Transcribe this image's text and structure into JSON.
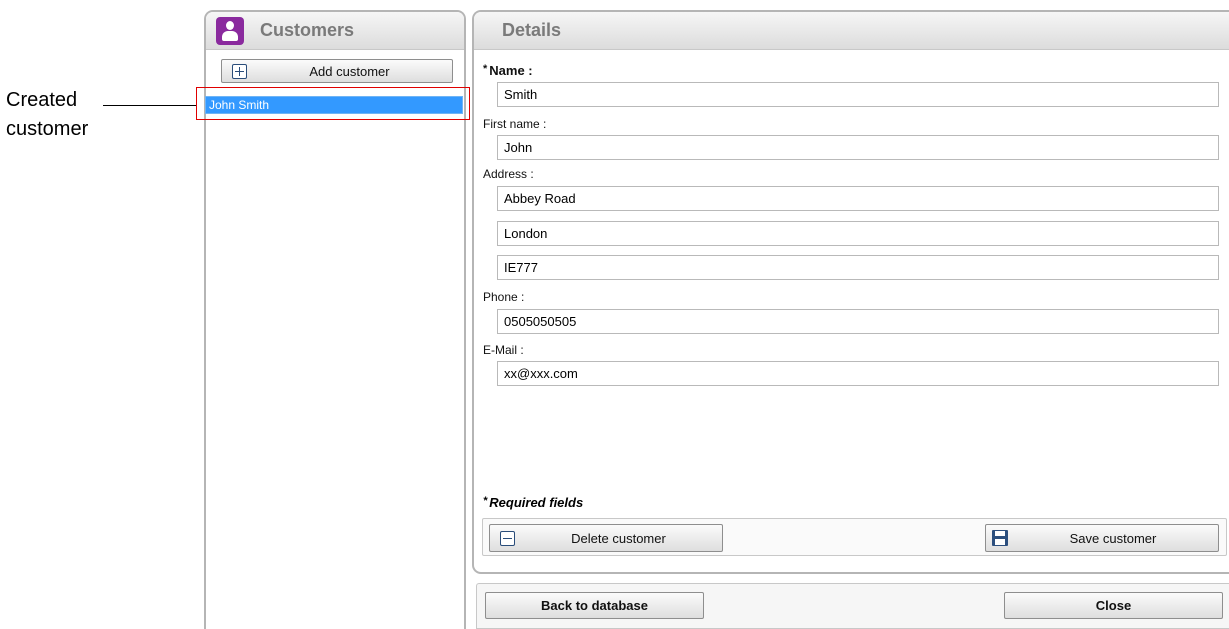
{
  "annotation": {
    "line1": "Created",
    "line2": "customer"
  },
  "customers_panel": {
    "title": "Customers",
    "add_button": "Add customer",
    "items": [
      {
        "label": "John Smith",
        "selected": true
      }
    ]
  },
  "details_panel": {
    "title": "Details",
    "required_marker": "*",
    "fields": {
      "name": {
        "label": "Name :",
        "value": "Smith"
      },
      "first_name": {
        "label": "First name :",
        "value": "John"
      },
      "address": {
        "label": "Address :",
        "line1": "Abbey Road",
        "line2": "London",
        "line3": "IE777"
      },
      "phone": {
        "label": "Phone :",
        "value": "0505050505"
      },
      "email": {
        "label": "E-Mail :",
        "value": "xx@xxx.com"
      }
    },
    "required_note": "Required fields",
    "delete_button": "Delete customer",
    "save_button": "Save customer"
  },
  "footer": {
    "back_button": "Back to database",
    "close_button": "Close"
  },
  "colors": {
    "selection": "#3399ff",
    "annotation_box": "#e00000",
    "icon_purple": "#8a2a9e",
    "icon_blue": "#2a4d7a"
  },
  "icons": [
    "customer-icon",
    "plus-icon",
    "minus-icon",
    "save-icon"
  ]
}
